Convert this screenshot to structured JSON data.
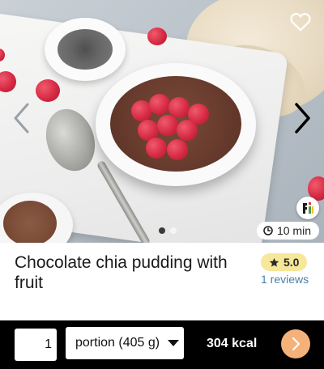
{
  "recipe": {
    "title": "Chocolate chia pudding with fruit",
    "time": "10 min",
    "rating": "5.0",
    "reviews": "1 reviews"
  },
  "carousel": {
    "slide_count": 2,
    "active_index": 0
  },
  "icons": {
    "favorite": "heart-outline-icon",
    "prev": "chevron-left-icon",
    "next": "chevron-right-icon",
    "time": "clock-icon",
    "rating": "star-icon",
    "brand": "brand-logo-icon",
    "dropdown": "caret-down-icon",
    "add": "chevron-right-icon"
  },
  "bottom_bar": {
    "quantity": "1",
    "portion": "portion (405 g)",
    "kcal": "304 kcal"
  },
  "colors": {
    "rating_bg": "#f6e79a",
    "reviews_link": "#4a7fa6",
    "bottom_bar": "#000000",
    "add_button": "#f4b27a"
  }
}
